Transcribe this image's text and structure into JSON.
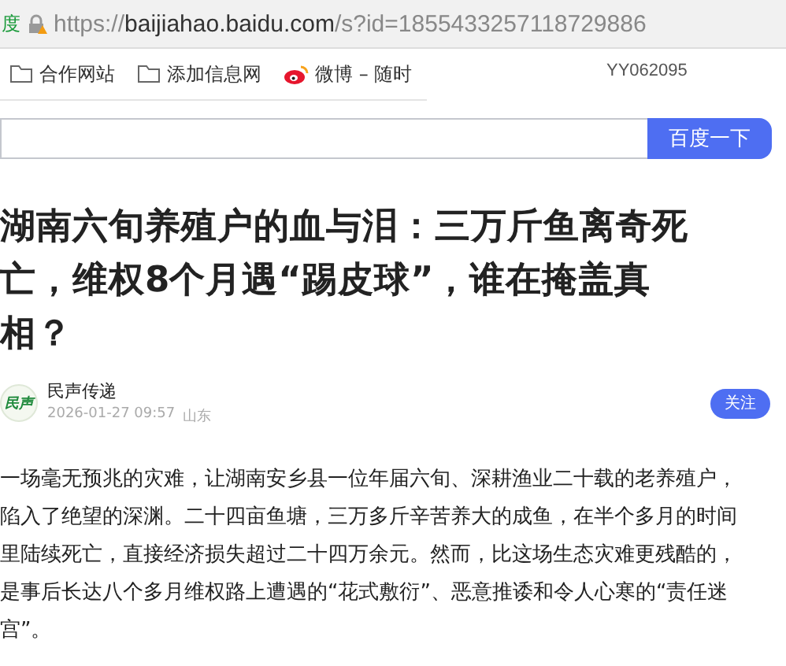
{
  "address_bar": {
    "site_label": "度",
    "url_host_prefix": "https://",
    "url_host": "baijiahao.baidu.com",
    "url_path": "/s?id=1855433257118729886"
  },
  "bookmarks": [
    {
      "kind": "folder",
      "label": "合作网站"
    },
    {
      "kind": "folder",
      "label": "添加信息网"
    },
    {
      "kind": "weibo",
      "label": "微博 – 随时"
    }
  ],
  "bookmark_note": "YY062095",
  "search": {
    "button": "百度一下"
  },
  "article": {
    "title_lines": [
      "湖南六旬养殖户的血与泪：三万斤鱼离奇死",
      "亡，维权8个月遇“踢皮球”，谁在掩盖真",
      "相？"
    ],
    "author": {
      "avatar_text": "民声",
      "name": "民声传递",
      "date": "2026-01-27 09:57",
      "location": "山东",
      "follow": "关注"
    },
    "body_lines": [
      "一场毫无预兆的灾难，让湖南安乡县一位年届六旬、深耕渔业二十载的老养殖户，",
      "陷入了绝望的深渊。二十四亩鱼塘，三万多斤辛苦养大的成鱼，在半个多月的时间",
      "里陆续死亡，直接经济损失超过二十四万余元。然而，比这场生态灾难更残酷的，",
      "是事后长达八个多月维权路上遭遇的“花式敷衍”、恶意推诿和令人心寒的“责任迷",
      "宫”。"
    ]
  }
}
